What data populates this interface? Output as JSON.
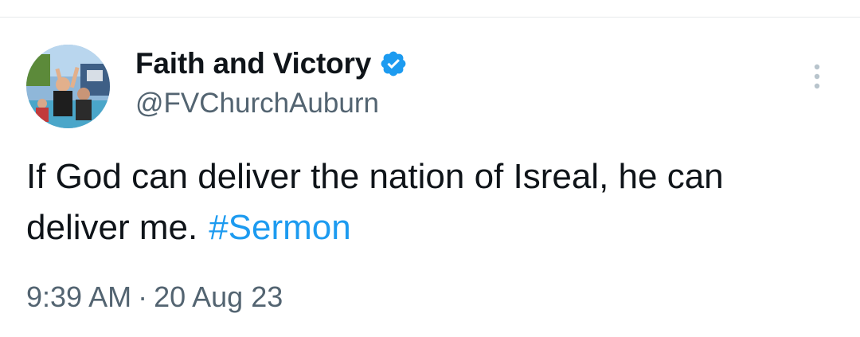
{
  "profile": {
    "display_name": "Faith and Victory",
    "handle": "@FVChurchAuburn",
    "verified_icon": "verified-badge-icon",
    "avatar_icon": "profile-photo"
  },
  "tweet": {
    "text": "If God can deliver the nation of Isreal, he can deliver me.",
    "hashtag": "#Sermon",
    "time": "9:39 AM",
    "separator": "·",
    "date": "20 Aug 23"
  },
  "menu": {
    "icon": "more-options-icon"
  },
  "colors": {
    "accent": "#1d9bf0",
    "secondary_text": "#536471",
    "primary_text": "#0f1419"
  }
}
